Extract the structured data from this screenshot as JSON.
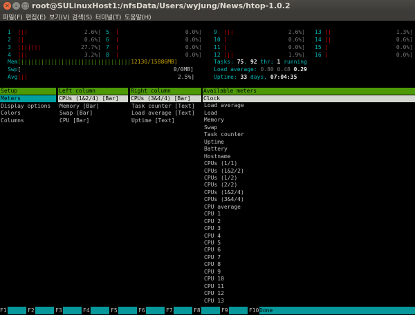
{
  "window": {
    "title": "root@SULinuxHost1:/nfsData/Users/wyjung/News/htop-1.0.2"
  },
  "menu": [
    "파일(F)",
    "편집(E)",
    "보기(V)",
    "검색(S)",
    "터미널(T)",
    "도움말(H)"
  ],
  "cpus": [
    {
      "n": "1",
      "bar": "[||",
      "pct": "2.6%]"
    },
    {
      "n": "2",
      "bar": "[|",
      "pct": "0.6%]"
    },
    {
      "n": "3",
      "bar": "[||||||",
      "pct": "27.7%]"
    },
    {
      "n": "4",
      "bar": "[||",
      "pct": "3.2%]"
    },
    {
      "n": "5",
      "bar": "[",
      "pct": "0.0%]"
    },
    {
      "n": "6",
      "bar": "[",
      "pct": "0.0%]"
    },
    {
      "n": "7",
      "bar": "[",
      "pct": "0.0%]"
    },
    {
      "n": "8",
      "bar": "[",
      "pct": "0.0%]"
    },
    {
      "n": "9",
      "bar": "[||",
      "pct": "2.6%]"
    },
    {
      "n": "10",
      "bar": "[",
      "pct": "0.6%]"
    },
    {
      "n": "11",
      "bar": "[",
      "pct": "0.0%]"
    },
    {
      "n": "12",
      "bar": "[||",
      "pct": "1.9%]"
    },
    {
      "n": "13",
      "bar": "[|",
      "pct": "1.3%]"
    },
    {
      "n": "14",
      "bar": "[|",
      "pct": "0.6%]"
    },
    {
      "n": "15",
      "bar": "[",
      "pct": "0.0%]"
    },
    {
      "n": "16",
      "bar": "[",
      "pct": "0.0%]"
    }
  ],
  "mem": {
    "label": "Mem",
    "bar": "[|||||||||||||||||||||||||||||||||",
    "val": "1213",
    "val2": "0/15886MB]"
  },
  "swp": {
    "label": "Swp",
    "bar": "[",
    "val": "0/0MB]"
  },
  "avg": {
    "label": "Avg",
    "bar": "[||",
    "val": "2.5%]"
  },
  "tasks": {
    "label": "Tasks: ",
    "count": "75",
    "sep": ", ",
    "thr": "92",
    "thr_label": " thr; ",
    "run": "1",
    "run_label": " running"
  },
  "load": {
    "label": "Load average: ",
    "v1": "0.80",
    "v2": "0.48",
    "v3": "0.29"
  },
  "uptime": {
    "label": "Uptime: ",
    "days": "33",
    "days_label": " days, ",
    "time": "07:04:35"
  },
  "setup": {
    "header": "Setup",
    "items": [
      "Meters",
      "Display options",
      "Colors",
      "Columns"
    ]
  },
  "left_column": {
    "header": "Left column",
    "items": [
      "CPUs (1&2/4) [Bar]",
      "Memory [Bar]",
      "Swap [Bar]",
      "CPU [Bar]"
    ]
  },
  "right_column": {
    "header": "Right column",
    "items": [
      "CPUs (3&4/4) [Bar]",
      "Task counter [Text]",
      "Load average [Text]",
      "Uptime [Text]"
    ]
  },
  "available": {
    "header": "Available meters",
    "items": [
      "Clock",
      "Load average",
      "Load",
      "Memory",
      "Swap",
      "Task counter",
      "Uptime",
      "Battery",
      "Hostname",
      "CPUs (1/1)",
      "CPUs (1&2/2)",
      "CPUs (1/2)",
      "CPUs (2/2)",
      "CPUs (1&2/4)",
      "CPUs (3&4/4)",
      "CPU average",
      "CPU 1",
      "CPU 2",
      "CPU 3",
      "CPU 4",
      "CPU 5",
      "CPU 6",
      "CPU 7",
      "CPU 8",
      "CPU 9",
      "CPU 10",
      "CPU 11",
      "CPU 12",
      "CPU 13"
    ]
  },
  "fkeys": [
    {
      "k": "F1",
      "l": ""
    },
    {
      "k": "F2",
      "l": ""
    },
    {
      "k": "F3",
      "l": ""
    },
    {
      "k": "F4",
      "l": ""
    },
    {
      "k": "F5",
      "l": ""
    },
    {
      "k": "F6",
      "l": ""
    },
    {
      "k": "F7",
      "l": ""
    },
    {
      "k": "F8",
      "l": ""
    },
    {
      "k": "F9",
      "l": ""
    },
    {
      "k": "F10",
      "l": "Done"
    }
  ]
}
